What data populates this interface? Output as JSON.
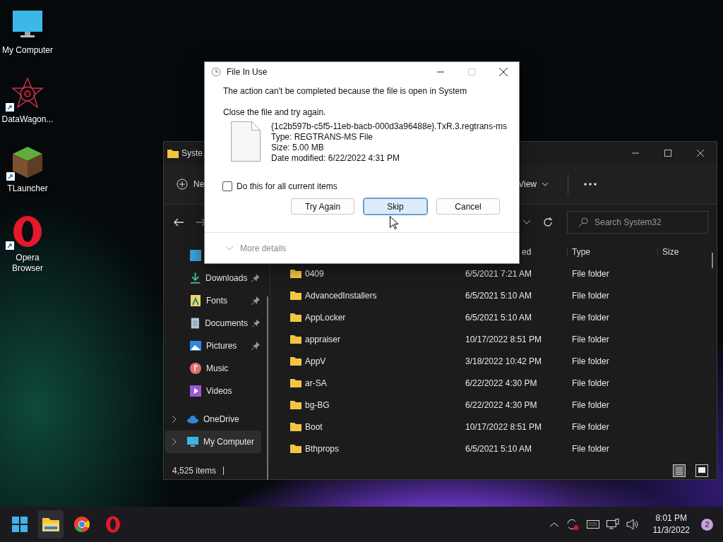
{
  "desktop_icons": [
    {
      "label": "My Computer",
      "kind": "monitor",
      "shortcut": false
    },
    {
      "label": "DataWagon...",
      "kind": "star",
      "shortcut": true
    },
    {
      "label": "TLauncher",
      "kind": "cube",
      "shortcut": true
    },
    {
      "label": "Opera Browser",
      "kind": "opera",
      "shortcut": true
    }
  ],
  "explorer": {
    "title": "Syste",
    "new_label": "Ne",
    "view_label": "View",
    "search": {
      "placeholder": "Search System32"
    },
    "columns": [
      "ed",
      "Type",
      "Size"
    ],
    "sidebar": [
      {
        "kind": "desktop",
        "pinned": false,
        "expandable": false,
        "selected": false
      },
      {
        "label": "Downloads",
        "kind": "downloads",
        "pinned": true,
        "expandable": false,
        "selected": false
      },
      {
        "label": "Fonts",
        "kind": "fonts",
        "pinned": true,
        "expandable": false,
        "selected": false
      },
      {
        "label": "Documents",
        "kind": "documents",
        "pinned": true,
        "expandable": false,
        "selected": false
      },
      {
        "label": "Pictures",
        "kind": "pictures",
        "pinned": true,
        "expandable": false,
        "selected": false
      },
      {
        "label": "Music",
        "kind": "music",
        "pinned": false,
        "expandable": false,
        "selected": false
      },
      {
        "label": "Videos",
        "kind": "videos",
        "pinned": false,
        "expandable": false,
        "selected": false
      },
      {
        "label": "OneDrive",
        "kind": "onedrive",
        "pinned": false,
        "expandable": true,
        "selected": false
      },
      {
        "label": "My Computer",
        "kind": "computer",
        "pinned": false,
        "expandable": true,
        "selected": true
      }
    ],
    "rows": [
      {
        "name": "0409",
        "date": "6/5/2021 7:21 AM",
        "type": "File folder"
      },
      {
        "name": "AdvancedInstallers",
        "date": "6/5/2021 5:10 AM",
        "type": "File folder"
      },
      {
        "name": "AppLocker",
        "date": "6/5/2021 5:10 AM",
        "type": "File folder"
      },
      {
        "name": "appraiser",
        "date": "10/17/2022 8:51 PM",
        "type": "File folder"
      },
      {
        "name": "AppV",
        "date": "3/18/2022 10:42 PM",
        "type": "File folder"
      },
      {
        "name": "ar-SA",
        "date": "6/22/2022 4:30 PM",
        "type": "File folder"
      },
      {
        "name": "bg-BG",
        "date": "6/22/2022 4:30 PM",
        "type": "File folder"
      },
      {
        "name": "Boot",
        "date": "10/17/2022 8:51 PM",
        "type": "File folder"
      },
      {
        "name": "Bthprops",
        "date": "6/5/2021 5:10 AM",
        "type": "File folder"
      }
    ],
    "status_bar": {
      "count": "4,525 items"
    },
    "view_modes": [
      {
        "kind": "details",
        "selected": true
      },
      {
        "kind": "tiles",
        "selected": false
      }
    ]
  },
  "dialog": {
    "title": "File In Use",
    "message": "The action can't be completed because the file is open in System",
    "instruction": "Close the file and try again.",
    "file": {
      "name": "{1c2b597b-c5f5-11eb-bacb-000d3a96488e}.TxR.3.regtrans-ms",
      "type": "Type: REGTRANS-MS File",
      "size": "Size: 5.00 MB",
      "modified": "Date modified: 6/22/2022 4:31 PM"
    },
    "apply_all": {
      "label": "Do this for all current items",
      "checked": false
    },
    "buttons": [
      {
        "label": "Try Again",
        "default": false
      },
      {
        "label": "Skip",
        "default": true
      },
      {
        "label": "Cancel",
        "default": false
      }
    ],
    "more_details": "More details"
  },
  "taskbar": {
    "apps": [
      {
        "kind": "start",
        "active": false
      },
      {
        "kind": "explorer",
        "active": true
      },
      {
        "kind": "chrome",
        "active": false
      },
      {
        "kind": "opera",
        "active": false
      }
    ],
    "time": "8:01 PM",
    "date": "11/3/2022",
    "notifications": "2"
  }
}
